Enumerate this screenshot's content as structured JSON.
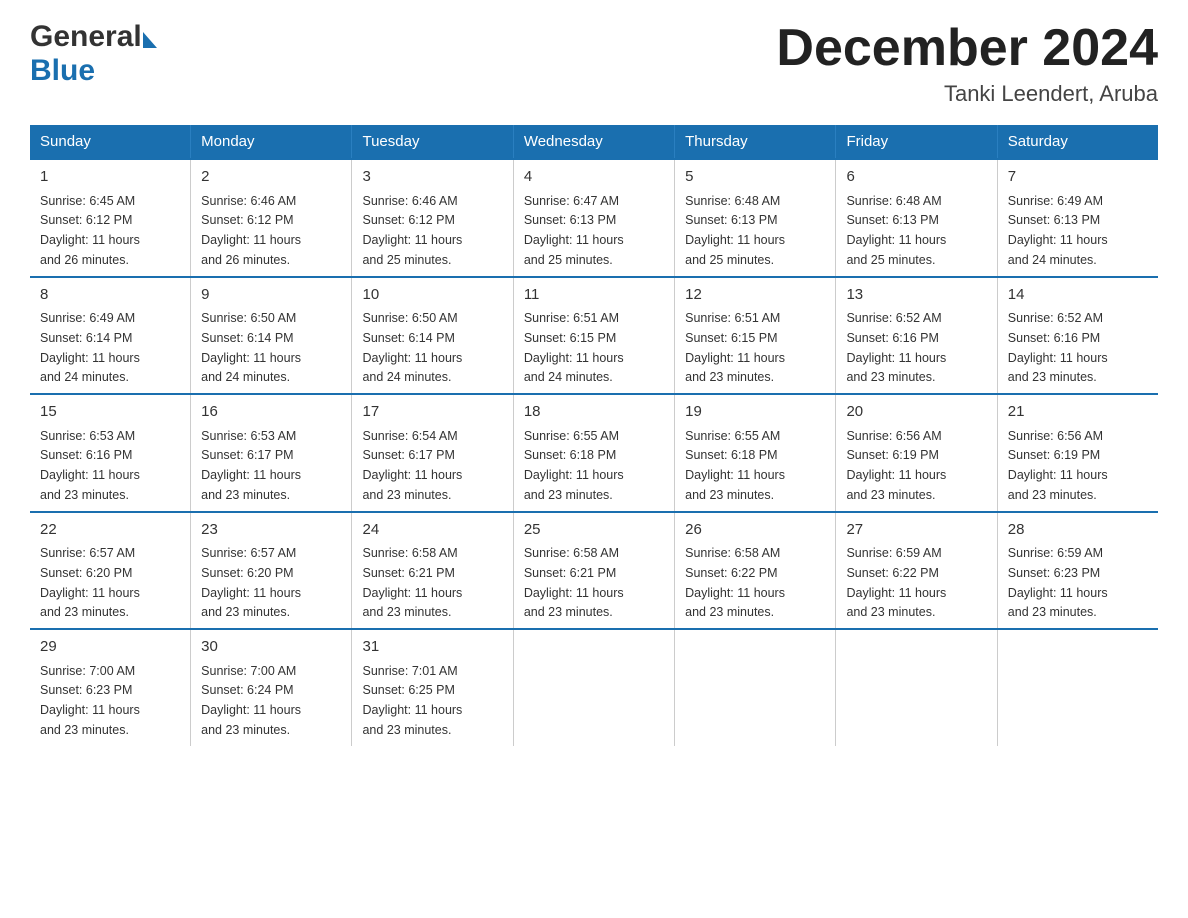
{
  "header": {
    "logo_general": "General",
    "logo_blue": "Blue",
    "month_title": "December 2024",
    "location": "Tanki Leendert, Aruba"
  },
  "days_of_week": [
    "Sunday",
    "Monday",
    "Tuesday",
    "Wednesday",
    "Thursday",
    "Friday",
    "Saturday"
  ],
  "weeks": [
    [
      {
        "day": "1",
        "sunrise": "6:45 AM",
        "sunset": "6:12 PM",
        "daylight": "11 hours and 26 minutes."
      },
      {
        "day": "2",
        "sunrise": "6:46 AM",
        "sunset": "6:12 PM",
        "daylight": "11 hours and 26 minutes."
      },
      {
        "day": "3",
        "sunrise": "6:46 AM",
        "sunset": "6:12 PM",
        "daylight": "11 hours and 25 minutes."
      },
      {
        "day": "4",
        "sunrise": "6:47 AM",
        "sunset": "6:13 PM",
        "daylight": "11 hours and 25 minutes."
      },
      {
        "day": "5",
        "sunrise": "6:48 AM",
        "sunset": "6:13 PM",
        "daylight": "11 hours and 25 minutes."
      },
      {
        "day": "6",
        "sunrise": "6:48 AM",
        "sunset": "6:13 PM",
        "daylight": "11 hours and 25 minutes."
      },
      {
        "day": "7",
        "sunrise": "6:49 AM",
        "sunset": "6:13 PM",
        "daylight": "11 hours and 24 minutes."
      }
    ],
    [
      {
        "day": "8",
        "sunrise": "6:49 AM",
        "sunset": "6:14 PM",
        "daylight": "11 hours and 24 minutes."
      },
      {
        "day": "9",
        "sunrise": "6:50 AM",
        "sunset": "6:14 PM",
        "daylight": "11 hours and 24 minutes."
      },
      {
        "day": "10",
        "sunrise": "6:50 AM",
        "sunset": "6:14 PM",
        "daylight": "11 hours and 24 minutes."
      },
      {
        "day": "11",
        "sunrise": "6:51 AM",
        "sunset": "6:15 PM",
        "daylight": "11 hours and 24 minutes."
      },
      {
        "day": "12",
        "sunrise": "6:51 AM",
        "sunset": "6:15 PM",
        "daylight": "11 hours and 23 minutes."
      },
      {
        "day": "13",
        "sunrise": "6:52 AM",
        "sunset": "6:16 PM",
        "daylight": "11 hours and 23 minutes."
      },
      {
        "day": "14",
        "sunrise": "6:52 AM",
        "sunset": "6:16 PM",
        "daylight": "11 hours and 23 minutes."
      }
    ],
    [
      {
        "day": "15",
        "sunrise": "6:53 AM",
        "sunset": "6:16 PM",
        "daylight": "11 hours and 23 minutes."
      },
      {
        "day": "16",
        "sunrise": "6:53 AM",
        "sunset": "6:17 PM",
        "daylight": "11 hours and 23 minutes."
      },
      {
        "day": "17",
        "sunrise": "6:54 AM",
        "sunset": "6:17 PM",
        "daylight": "11 hours and 23 minutes."
      },
      {
        "day": "18",
        "sunrise": "6:55 AM",
        "sunset": "6:18 PM",
        "daylight": "11 hours and 23 minutes."
      },
      {
        "day": "19",
        "sunrise": "6:55 AM",
        "sunset": "6:18 PM",
        "daylight": "11 hours and 23 minutes."
      },
      {
        "day": "20",
        "sunrise": "6:56 AM",
        "sunset": "6:19 PM",
        "daylight": "11 hours and 23 minutes."
      },
      {
        "day": "21",
        "sunrise": "6:56 AM",
        "sunset": "6:19 PM",
        "daylight": "11 hours and 23 minutes."
      }
    ],
    [
      {
        "day": "22",
        "sunrise": "6:57 AM",
        "sunset": "6:20 PM",
        "daylight": "11 hours and 23 minutes."
      },
      {
        "day": "23",
        "sunrise": "6:57 AM",
        "sunset": "6:20 PM",
        "daylight": "11 hours and 23 minutes."
      },
      {
        "day": "24",
        "sunrise": "6:58 AM",
        "sunset": "6:21 PM",
        "daylight": "11 hours and 23 minutes."
      },
      {
        "day": "25",
        "sunrise": "6:58 AM",
        "sunset": "6:21 PM",
        "daylight": "11 hours and 23 minutes."
      },
      {
        "day": "26",
        "sunrise": "6:58 AM",
        "sunset": "6:22 PM",
        "daylight": "11 hours and 23 minutes."
      },
      {
        "day": "27",
        "sunrise": "6:59 AM",
        "sunset": "6:22 PM",
        "daylight": "11 hours and 23 minutes."
      },
      {
        "day": "28",
        "sunrise": "6:59 AM",
        "sunset": "6:23 PM",
        "daylight": "11 hours and 23 minutes."
      }
    ],
    [
      {
        "day": "29",
        "sunrise": "7:00 AM",
        "sunset": "6:23 PM",
        "daylight": "11 hours and 23 minutes."
      },
      {
        "day": "30",
        "sunrise": "7:00 AM",
        "sunset": "6:24 PM",
        "daylight": "11 hours and 23 minutes."
      },
      {
        "day": "31",
        "sunrise": "7:01 AM",
        "sunset": "6:25 PM",
        "daylight": "11 hours and 23 minutes."
      },
      null,
      null,
      null,
      null
    ]
  ],
  "labels": {
    "sunrise": "Sunrise: ",
    "sunset": "Sunset: ",
    "daylight": "Daylight: "
  },
  "colors": {
    "header_bg": "#1a6faf",
    "header_text": "#ffffff",
    "border_top": "#1a6faf"
  }
}
